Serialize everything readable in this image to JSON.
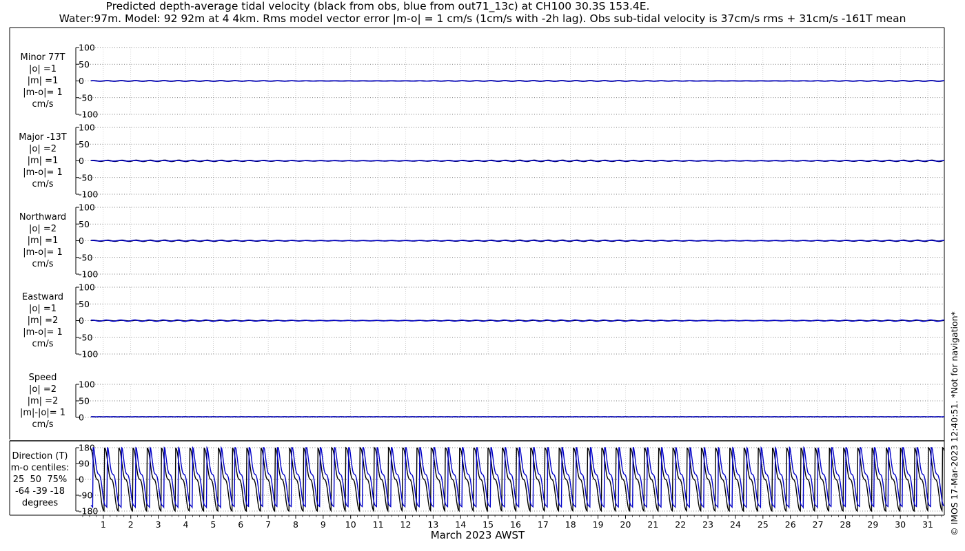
{
  "title_line1": "Predicted depth-average tidal velocity (black from obs, blue from out71_13c) at CH100 30.3S 153.4E.",
  "title_line2": "Water:97m. Model: 92 92m at 4 4km. Rms model vector error |m-o| = 1 cm/s (1cm/s with -2h lag). Obs sub-tidal velocity is 37cm/s rms + 31cm/s -161T mean",
  "xlabel": "March 2023 AWST",
  "copyright": "© IMOS 17-Mar-2023 12:40:51. *Not for navigation*",
  "colors": {
    "obs": "#000000",
    "model": "#0000c8",
    "grid": "#b0b0b0"
  },
  "chart_data": [
    {
      "type": "line",
      "name": "minor",
      "label_lines": [
        "Minor 77T",
        "|o| =1",
        "|m| =1",
        "|m-o|= 1",
        "cm/s"
      ],
      "ylim": [
        -100,
        100
      ],
      "yticks": [
        100,
        50,
        0,
        -50,
        -100
      ],
      "xlim": [
        0,
        31.6
      ],
      "xticks": [
        1,
        2,
        3,
        4,
        5,
        6,
        7,
        8,
        9,
        10,
        11,
        12,
        13,
        14,
        15,
        16,
        17,
        18,
        19,
        20,
        21,
        22,
        23,
        24,
        25,
        26,
        27,
        28,
        29,
        30,
        31
      ],
      "series": [
        {
          "role": "obs",
          "amplitude": 1
        },
        {
          "role": "model",
          "amplitude": 1
        }
      ]
    },
    {
      "type": "line",
      "name": "major",
      "label_lines": [
        "Major -13T",
        "|o| =2",
        "|m| =1",
        "|m-o|= 1",
        "cm/s"
      ],
      "ylim": [
        -100,
        100
      ],
      "yticks": [
        100,
        50,
        0,
        -50,
        -100
      ],
      "xlim": [
        0,
        31.6
      ],
      "xticks": [
        1,
        2,
        3,
        4,
        5,
        6,
        7,
        8,
        9,
        10,
        11,
        12,
        13,
        14,
        15,
        16,
        17,
        18,
        19,
        20,
        21,
        22,
        23,
        24,
        25,
        26,
        27,
        28,
        29,
        30,
        31
      ],
      "series": [
        {
          "role": "obs",
          "amplitude": 2
        },
        {
          "role": "model",
          "amplitude": 1
        }
      ]
    },
    {
      "type": "line",
      "name": "northward",
      "label_lines": [
        "Northward",
        "|o| =2",
        "|m| =1",
        "|m-o|= 1",
        "cm/s"
      ],
      "ylim": [
        -100,
        100
      ],
      "yticks": [
        100,
        50,
        0,
        -50,
        -100
      ],
      "xlim": [
        0,
        31.6
      ],
      "xticks": [
        1,
        2,
        3,
        4,
        5,
        6,
        7,
        8,
        9,
        10,
        11,
        12,
        13,
        14,
        15,
        16,
        17,
        18,
        19,
        20,
        21,
        22,
        23,
        24,
        25,
        26,
        27,
        28,
        29,
        30,
        31
      ],
      "series": [
        {
          "role": "obs",
          "amplitude": 2
        },
        {
          "role": "model",
          "amplitude": 1
        }
      ]
    },
    {
      "type": "line",
      "name": "eastward",
      "label_lines": [
        "Eastward",
        "|o| =1",
        "|m| =2",
        "|m-o|= 1",
        "cm/s"
      ],
      "ylim": [
        -100,
        100
      ],
      "yticks": [
        100,
        50,
        0,
        -50,
        -100
      ],
      "xlim": [
        0,
        31.6
      ],
      "xticks": [
        1,
        2,
        3,
        4,
        5,
        6,
        7,
        8,
        9,
        10,
        11,
        12,
        13,
        14,
        15,
        16,
        17,
        18,
        19,
        20,
        21,
        22,
        23,
        24,
        25,
        26,
        27,
        28,
        29,
        30,
        31
      ],
      "series": [
        {
          "role": "obs",
          "amplitude": 1
        },
        {
          "role": "model",
          "amplitude": 2
        }
      ]
    },
    {
      "type": "line",
      "name": "speed",
      "label_lines": [
        "Speed",
        "|o| =2",
        "|m| =2",
        "|m|-|o|= 1",
        "cm/s"
      ],
      "ylim": [
        0,
        100
      ],
      "yticks": [
        100,
        50,
        0
      ],
      "xlim": [
        0,
        31.6
      ],
      "xticks": [
        1,
        2,
        3,
        4,
        5,
        6,
        7,
        8,
        9,
        10,
        11,
        12,
        13,
        14,
        15,
        16,
        17,
        18,
        19,
        20,
        21,
        22,
        23,
        24,
        25,
        26,
        27,
        28,
        29,
        30,
        31
      ],
      "series": [
        {
          "role": "obs",
          "amplitude": 2
        },
        {
          "role": "model",
          "amplitude": 2
        }
      ]
    },
    {
      "type": "line",
      "name": "direction",
      "label_lines": [
        "Direction (T)",
        "m-o centiles:",
        "25  50  75%",
        "-64 -39 -18",
        "degrees"
      ],
      "ylim": [
        -180,
        180
      ],
      "yticks": [
        180,
        90,
        0,
        -90,
        -180
      ],
      "xlim": [
        0,
        31.6
      ],
      "xticks": [
        1,
        2,
        3,
        4,
        5,
        6,
        7,
        8,
        9,
        10,
        11,
        12,
        13,
        14,
        15,
        16,
        17,
        18,
        19,
        20,
        21,
        22,
        23,
        24,
        25,
        26,
        27,
        28,
        29,
        30,
        31
      ],
      "series": [
        {
          "role": "obs",
          "period_days": 0.517
        },
        {
          "role": "model",
          "period_days": 0.517,
          "lag_days": 0.1
        }
      ]
    }
  ]
}
